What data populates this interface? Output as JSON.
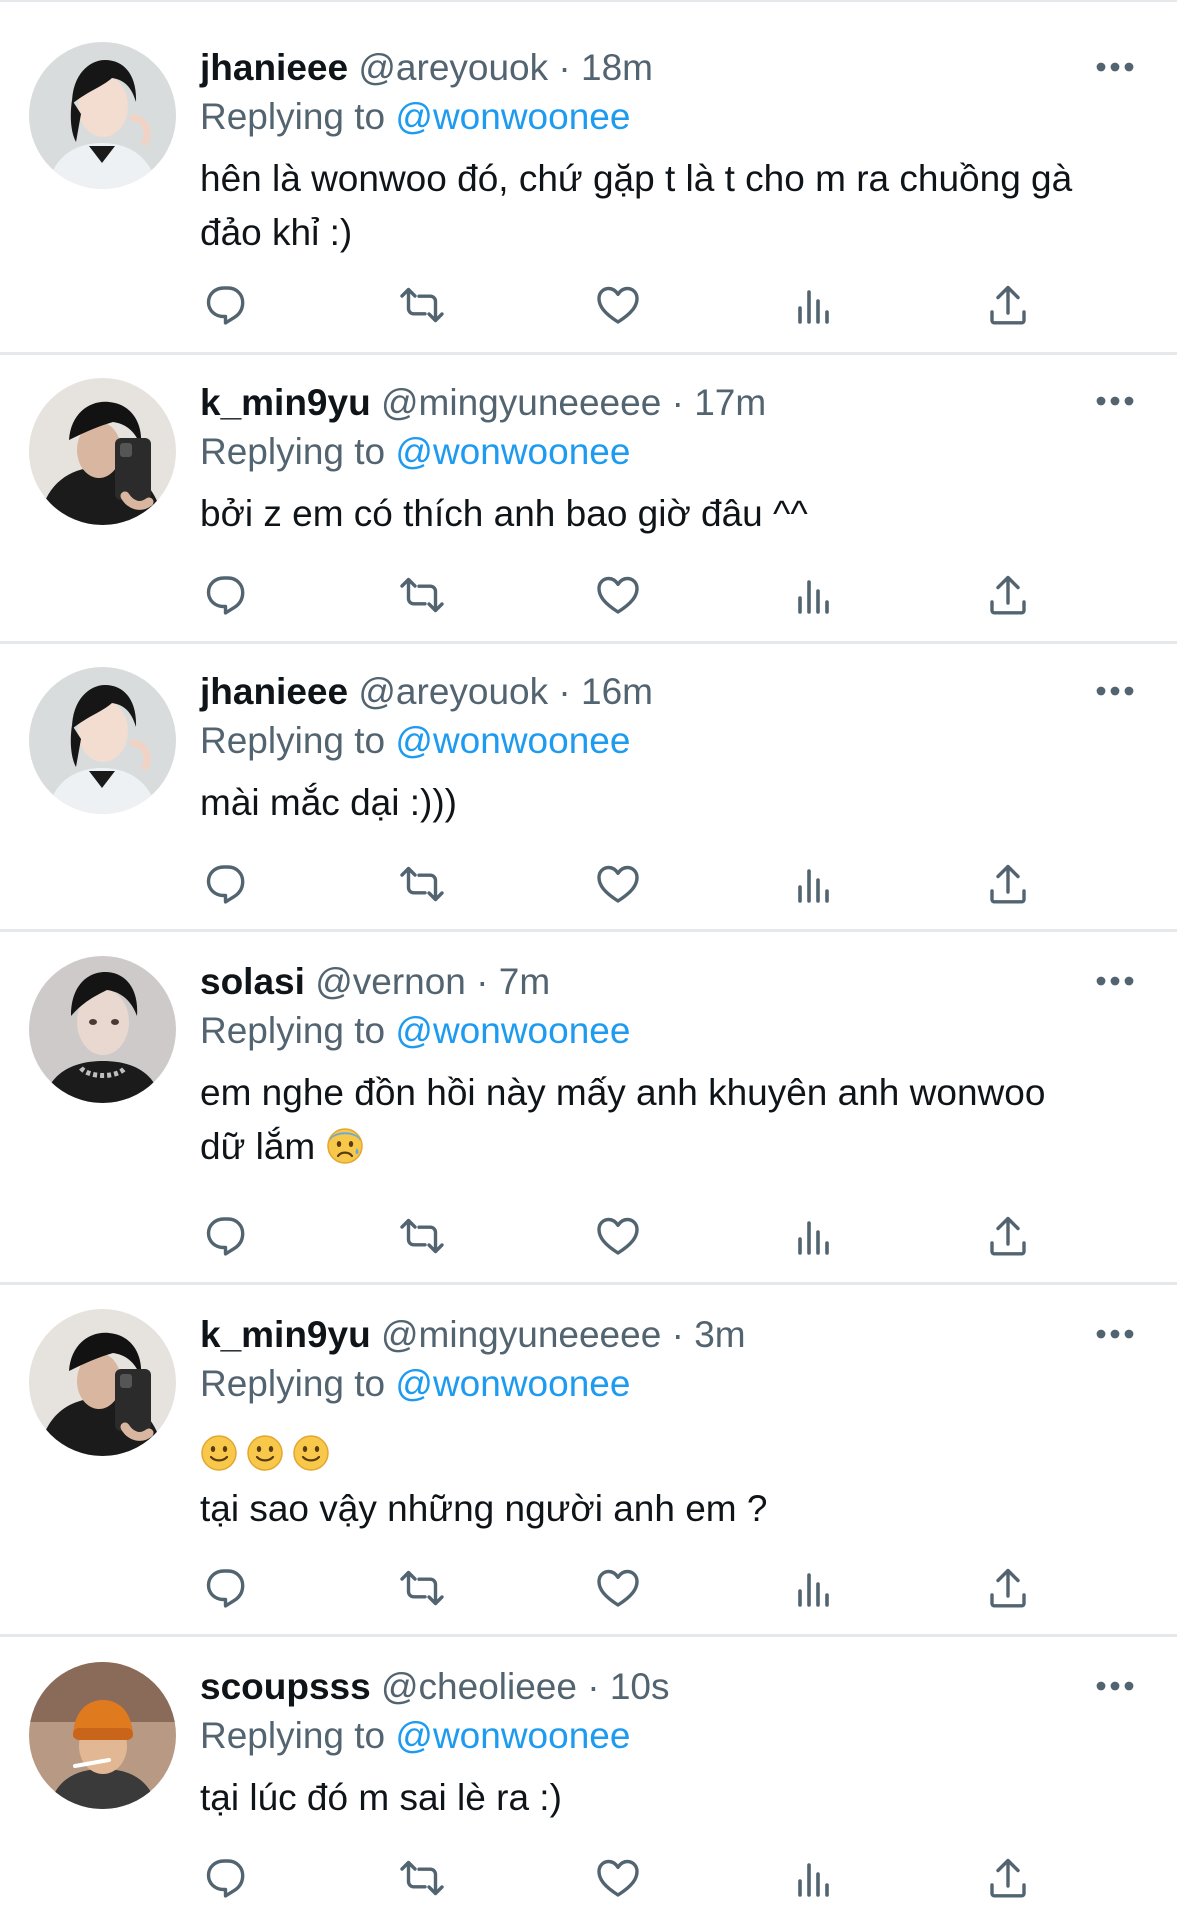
{
  "reply_prefix": "Replying to",
  "colors": {
    "accent": "#1d9bf0",
    "secondary_text": "#536471",
    "primary_text": "#0f1419",
    "divider": "#e6e9eb"
  },
  "action_icons": [
    "reply-icon",
    "retweet-icon",
    "like-icon",
    "views-icon",
    "share-icon"
  ],
  "tweets": [
    {
      "name": "jhanieee",
      "handle": "@areyouok",
      "time": "18m",
      "reply_to": "@wonwoonee",
      "lines": [
        "hên là wonwoo đó, chứ gặp t là t cho m ra chuồng gà",
        "đảo khỉ :)"
      ]
    },
    {
      "name": "k_min9yu",
      "handle": "@mingyuneeeee",
      "time": "17m",
      "reply_to": "@wonwoonee",
      "lines": [
        "bởi z em có thích anh bao giờ đâu ^^"
      ]
    },
    {
      "name": "jhanieee",
      "handle": "@areyouok",
      "time": "16m",
      "reply_to": "@wonwoonee",
      "lines": [
        "mài mắc dại :)))"
      ]
    },
    {
      "name": "solasi",
      "handle": "@vernon",
      "time": "7m",
      "reply_to": "@wonwoonee",
      "lines": [
        "em nghe đồn hồi này mấy anh khuyên anh wonwoo",
        "dữ lắm"
      ],
      "trailing_emoji": "anxious-face-emoji"
    },
    {
      "name": "k_min9yu",
      "handle": "@mingyuneeeee",
      "time": "3m",
      "reply_to": "@wonwoonee",
      "emojis": [
        "slightly-smiling-face-emoji",
        "slightly-smiling-face-emoji",
        "slightly-smiling-face-emoji"
      ],
      "lines": [
        "tại sao vậy những người anh em ?"
      ]
    },
    {
      "name": "scoupsss",
      "handle": "@cheolieee",
      "time": "10s",
      "reply_to": "@wonwoonee",
      "lines": [
        "tại lúc đó m sai lè ra :)"
      ]
    }
  ]
}
